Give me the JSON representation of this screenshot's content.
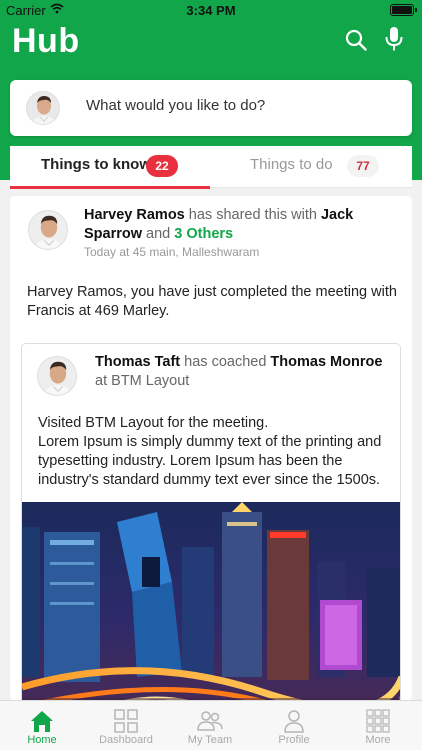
{
  "status_bar": {
    "carrier": "Carrier",
    "time": "3:34 PM"
  },
  "header": {
    "title": "Hub"
  },
  "ask_bar": {
    "placeholder": "What would you like to do?"
  },
  "tabs": [
    {
      "label": "Things to know",
      "count": "22",
      "active": true
    },
    {
      "label": "Things to do",
      "count": "77",
      "active": false
    }
  ],
  "post": {
    "author": "Harvey Ramos",
    "shared_text": "has shared this with",
    "recipient": "Jack Sparrow",
    "and_text": "and",
    "others": "3 Others",
    "meta": "Today at 45 main, Malleshwaram",
    "body": "Harvey Ramos, you have just completed the meeting with Francis at 469 Marley."
  },
  "coaching": {
    "coach": "Thomas Taft",
    "action": "has coached",
    "coachee": "Thomas Monroe",
    "location": "at BTM Layout",
    "line1": "Visited BTM Layout for the meeting.",
    "line2": "Lorem Ipsum is simply dummy text of the printing and typesetting industry. Lorem Ipsum has been the industry's standard dummy text ever since the 1500s."
  },
  "tab_bar": [
    {
      "label": "Home",
      "icon": "home-icon",
      "active": true
    },
    {
      "label": "Dashboard",
      "icon": "dashboard-icon",
      "active": false
    },
    {
      "label": "My Team",
      "icon": "team-icon",
      "active": false
    },
    {
      "label": "Profile",
      "icon": "profile-icon",
      "active": false
    },
    {
      "label": "More",
      "icon": "more-icon",
      "active": false
    }
  ],
  "colors": {
    "brand_green": "#12a64a",
    "badge_red": "#e8303f"
  }
}
